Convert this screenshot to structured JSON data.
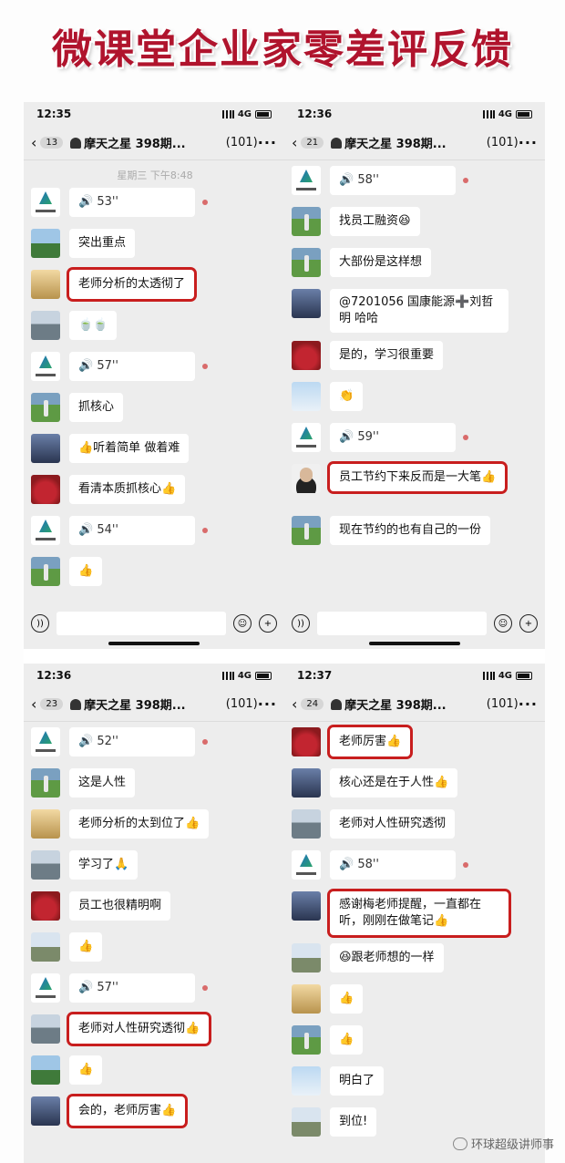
{
  "banner": {
    "title": "微课堂企业家零差评反馈"
  },
  "watermark": {
    "text": "环球超级讲师事"
  },
  "colors": {
    "highlight": "#c81e1e",
    "banner": "#b0142d",
    "chat_bg": "#ededed"
  },
  "panels": [
    {
      "time": "12:35",
      "network": "4G",
      "badge": "13",
      "title": "摩天之星 398期...",
      "count": "(101)",
      "date": "星期三 下午8:48",
      "messages": [
        {
          "avatar": "logo",
          "text": "🔊 53''",
          "voice": true,
          "dot": true
        },
        {
          "avatar": "land",
          "text": "突出重点"
        },
        {
          "avatar": "person",
          "text": "老师分析的太透彻了",
          "highlight": true
        },
        {
          "avatar": "build",
          "text": "🍵🍵"
        },
        {
          "avatar": "logo",
          "text": "🔊 57''",
          "voice": true,
          "dot": true
        },
        {
          "avatar": "golf",
          "text": "抓核心"
        },
        {
          "avatar": "church",
          "text": "👍听着简单 做着难"
        },
        {
          "avatar": "red",
          "text": "看清本质抓核心👍"
        },
        {
          "avatar": "logo",
          "text": "🔊 54''",
          "voice": true,
          "dot": true
        },
        {
          "avatar": "golf",
          "text": "👍"
        }
      ]
    },
    {
      "time": "12:36",
      "network": "4G",
      "badge": "21",
      "title": "摩天之星 398期...",
      "count": "(101)",
      "date": "",
      "messages": [
        {
          "avatar": "logo",
          "text": "🔊 58''",
          "voice": true,
          "dot": true
        },
        {
          "avatar": "golf",
          "text": "找员工融资😆"
        },
        {
          "avatar": "golf",
          "text": "大部份是这样想"
        },
        {
          "avatar": "church",
          "text": "@7201056 国康能源➕刘哲明 哈哈",
          "multi": true
        },
        {
          "avatar": "red",
          "text": "是的，学习很重要"
        },
        {
          "avatar": "sky",
          "text": "👏"
        },
        {
          "avatar": "logo",
          "text": "🔊 59''",
          "voice": true,
          "dot": true
        },
        {
          "avatar": "portrait",
          "text": "员工节约下来反而是一大笔👍",
          "multi": true,
          "highlight": true
        },
        {
          "avatar": "golf",
          "text": "现在节约的也有自己的一份"
        }
      ]
    },
    {
      "time": "12:36",
      "network": "4G",
      "badge": "23",
      "title": "摩天之星 398期...",
      "count": "(101)",
      "date": "",
      "messages": [
        {
          "avatar": "logo",
          "text": "🔊 52''",
          "voice": true,
          "dot": true
        },
        {
          "avatar": "golf",
          "text": "这是人性"
        },
        {
          "avatar": "person",
          "text": "老师分析的太到位了👍"
        },
        {
          "avatar": "build",
          "text": "学习了🙏"
        },
        {
          "avatar": "red",
          "text": "员工也很精明啊"
        },
        {
          "avatar": "tower",
          "text": "👍"
        },
        {
          "avatar": "logo",
          "text": "🔊 57''",
          "voice": true,
          "dot": true
        },
        {
          "avatar": "build",
          "text": "老师对人性研究透彻👍",
          "highlight": true
        },
        {
          "avatar": "land",
          "text": "👍"
        },
        {
          "avatar": "church",
          "text": "会的，老师厉害👍",
          "highlight": true
        }
      ]
    },
    {
      "time": "12:37",
      "network": "4G",
      "badge": "24",
      "title": "摩天之星 398期...",
      "count": "(101)",
      "date": "",
      "messages": [
        {
          "avatar": "red",
          "text": "老师厉害👍",
          "highlight": true
        },
        {
          "avatar": "church",
          "text": "核心还是在于人性👍"
        },
        {
          "avatar": "build",
          "text": "老师对人性研究透彻"
        },
        {
          "avatar": "logo",
          "text": "🔊 58''",
          "voice": true,
          "dot": true
        },
        {
          "avatar": "church",
          "text": "感谢梅老师提醒，一直都在听，刚刚在做笔记👍",
          "multi": true,
          "highlight": true
        },
        {
          "avatar": "tower",
          "text": "😆跟老师想的一样"
        },
        {
          "avatar": "person",
          "text": "👍"
        },
        {
          "avatar": "golf",
          "text": "👍"
        },
        {
          "avatar": "sky",
          "text": "明白了"
        },
        {
          "avatar": "tower",
          "text": "到位!"
        }
      ]
    }
  ]
}
